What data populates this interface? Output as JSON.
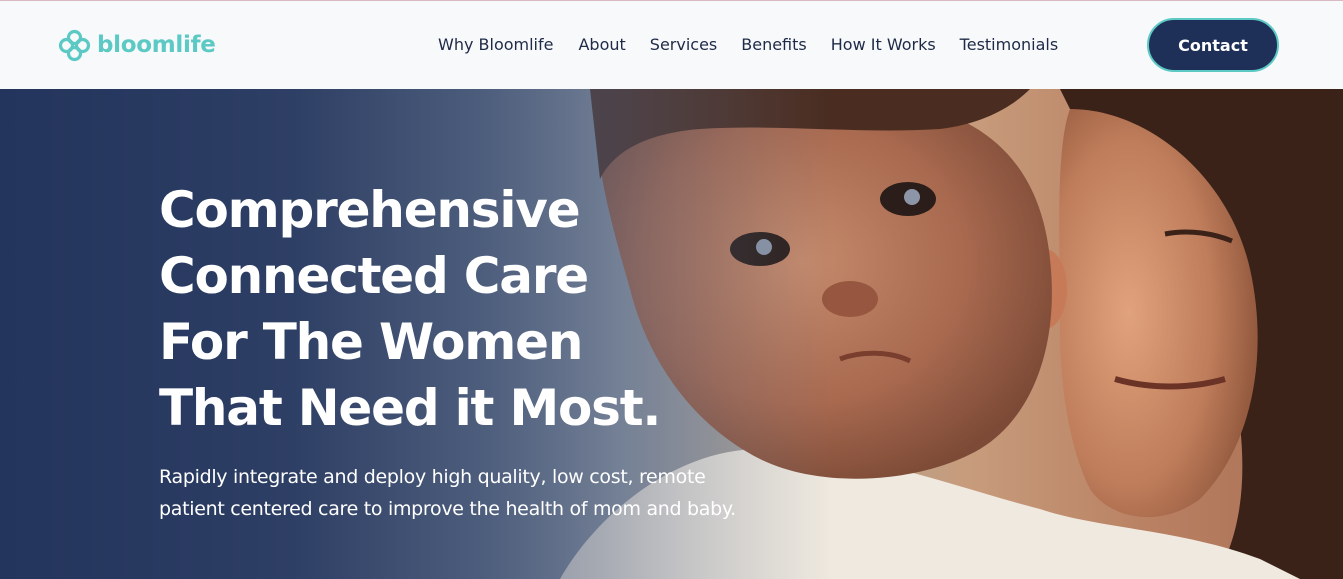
{
  "brand": {
    "name": "bloomlife",
    "color": "#5cc9c4"
  },
  "nav": {
    "items": [
      {
        "label": "Why Bloomlife"
      },
      {
        "label": "About"
      },
      {
        "label": "Services"
      },
      {
        "label": "Benefits"
      },
      {
        "label": "How It Works"
      },
      {
        "label": "Testimonials"
      }
    ],
    "text_color": "#1e2a47"
  },
  "contact_button": {
    "label": "Contact",
    "background": "#1f3058",
    "border": "#5cc9c4"
  },
  "hero": {
    "title_lines": [
      "Comprehensive",
      "Connected Care",
      "For The Women",
      "That Need it Most."
    ],
    "subtitle": "Rapidly integrate and deploy high quality, low cost, remote patient centered care to improve the health of mom and baby.",
    "image": "photo of a smiling mother holding her baby",
    "overlay_color": "#24355d"
  }
}
